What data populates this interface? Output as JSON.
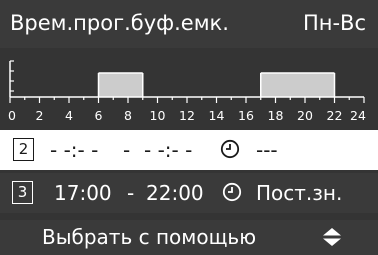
{
  "header": {
    "title": "Врем.прог.буф.емк.",
    "days": "Пн-Вс"
  },
  "chart_data": {
    "type": "bar",
    "x_ticks": [
      "0",
      "2",
      "4",
      "6",
      "8",
      "10",
      "12",
      "14",
      "16",
      "18",
      "20",
      "22",
      "24"
    ],
    "xlim": [
      0,
      24
    ],
    "intervals": [
      {
        "start": 6,
        "end": 9
      },
      {
        "start": 17,
        "end": 22
      }
    ],
    "colors": {
      "bar": "#cccccc",
      "axis": "#ffffff",
      "background": "#343434"
    }
  },
  "slots": [
    {
      "index": "2",
      "start": "- -:- -",
      "separator": "-",
      "end": "- -:- -",
      "mode": "---",
      "selected": true
    },
    {
      "index": "3",
      "start": "17:00",
      "separator": "-",
      "end": "22:00",
      "mode": "Пост.зн.",
      "selected": false
    }
  ],
  "footer": {
    "hint": "Выбрать с помощью",
    "icon": "up-down-arrows-icon"
  }
}
